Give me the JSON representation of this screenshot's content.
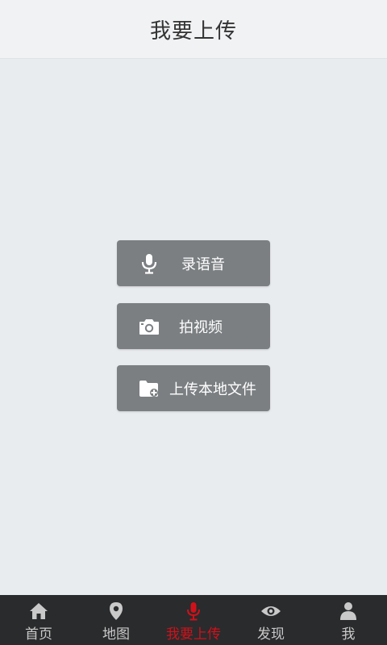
{
  "header": {
    "title": "我要上传"
  },
  "actions": {
    "record_audio": {
      "label": "录语音",
      "icon": "microphone-icon"
    },
    "record_video": {
      "label": "拍视频",
      "icon": "camera-icon"
    },
    "upload_local": {
      "label": "上传本地文件",
      "icon": "folder-add-icon"
    }
  },
  "tabbar": {
    "items": [
      {
        "label": "首页",
        "icon": "home-icon"
      },
      {
        "label": "地图",
        "icon": "map-pin-icon"
      },
      {
        "label": "我要上传",
        "icon": "microphone-icon",
        "active": true
      },
      {
        "label": "发现",
        "icon": "eye-icon"
      },
      {
        "label": "我",
        "icon": "user-icon"
      }
    ],
    "active_color": "#d0111a",
    "inactive_color": "#c9c9c9"
  },
  "colors": {
    "background": "#e9ecef",
    "header_bg": "#f1f2f4",
    "button_bg": "#7b7f82",
    "tabbar_bg": "#2a2b2d"
  }
}
